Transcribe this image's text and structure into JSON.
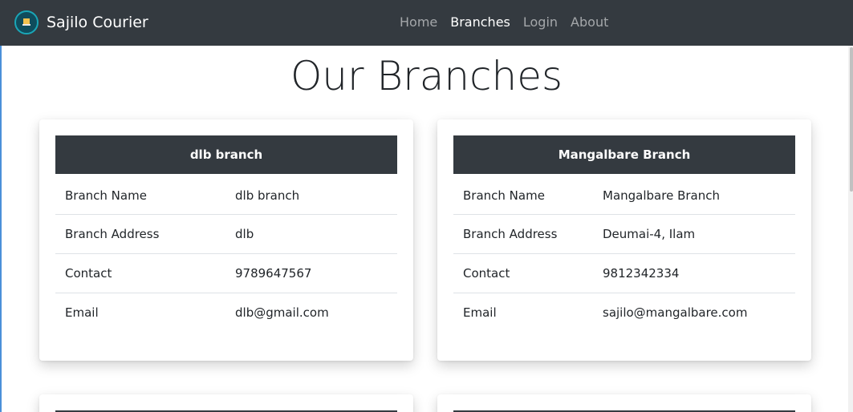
{
  "navbar": {
    "brand": "Sajilo Courier",
    "links": [
      {
        "label": "Home"
      },
      {
        "label": "Branches"
      },
      {
        "label": "Login"
      },
      {
        "label": "About"
      }
    ]
  },
  "page": {
    "title": "Our Branches"
  },
  "labels": {
    "name": "Branch Name",
    "address": "Branch Address",
    "contact": "Contact",
    "email": "Email"
  },
  "branches": [
    {
      "header": "dlb branch",
      "name": "dlb branch",
      "address": "dlb",
      "contact": "9789647567",
      "email": "dlb@gmail.com"
    },
    {
      "header": "Mangalbare Branch",
      "name": "Mangalbare Branch",
      "address": "Deumai-4, Ilam",
      "contact": "9812342334",
      "email": "sajilo@mangalbare.com"
    }
  ],
  "colors": {
    "navbar": "#343a40",
    "table_header": "#343a40",
    "text": "#212529",
    "nav_active": "#ffffff",
    "nav_inactive": "rgba(255,255,255,0.55)"
  },
  "icons": {
    "brand_logo": "courier-logo-icon"
  }
}
